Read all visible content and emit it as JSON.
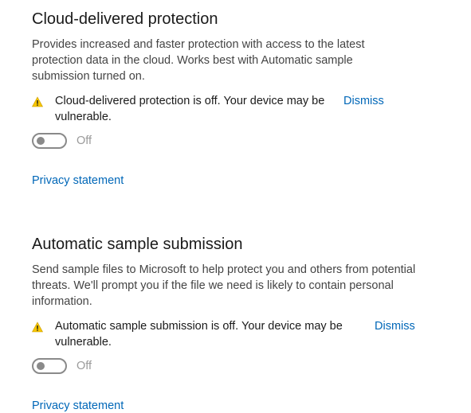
{
  "sections": [
    {
      "title": "Cloud-delivered protection",
      "description": "Provides increased and faster protection with access to the latest protection data in the cloud.  Works best with Automatic sample submission turned on.",
      "warning": "Cloud-delivered protection is off. Your device may be vulnerable.",
      "dismiss_label": "Dismiss",
      "toggle_state": "Off",
      "privacy_label": "Privacy statement"
    },
    {
      "title": "Automatic sample submission",
      "description": "Send sample files to Microsoft to help protect you and others from potential threats.  We'll prompt you if the file we need is likely to contain personal information.",
      "warning": "Automatic sample submission is off. Your device may be vulnerable.",
      "dismiss_label": "Dismiss",
      "toggle_state": "Off",
      "privacy_label": "Privacy statement"
    }
  ],
  "colors": {
    "link": "#0067b8",
    "warning_icon": "#f7c600",
    "toggle_off": "#8a8a8a"
  },
  "icons": {
    "warning": "warning-icon"
  }
}
